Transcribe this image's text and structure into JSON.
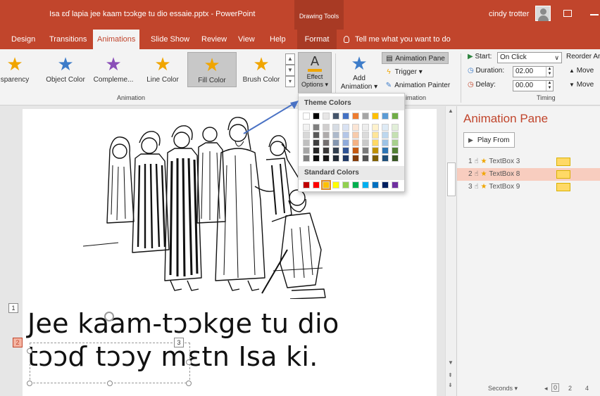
{
  "titlebar": {
    "doc_title": "Isa ɛɗ lapia jee kaam tɔɔkge tu dio essaie.pptx  -  PowerPoint",
    "context_label": "Drawing Tools",
    "user": "cindy trotter"
  },
  "tabs": {
    "items": [
      "Design",
      "Transitions",
      "Animations",
      "Slide Show",
      "Review",
      "View",
      "Help",
      "Format"
    ],
    "active": "Animations",
    "tell_me": "Tell me what you want to do"
  },
  "ribbon": {
    "gallery": [
      {
        "label": "sparency",
        "color": "#f0a500"
      },
      {
        "label": "Object Color",
        "color": "#3d7cc9"
      },
      {
        "label": "Compleme...",
        "color": "#8a4fb8"
      },
      {
        "label": "Line Color",
        "color": "#f0a500"
      },
      {
        "label": "Fill Color",
        "color": "#f0a500"
      },
      {
        "label": "Brush Color",
        "color": "#f0a500"
      }
    ],
    "selected_gallery_item": "Fill Color",
    "animation_group_label": "Animation",
    "effect_options": {
      "letter": "A",
      "line1": "Effect",
      "line2": "Options ▾"
    },
    "add_animation": {
      "line1": "Add",
      "line2": "Animation ▾"
    },
    "animation_pane_btn": "Animation Pane",
    "trigger_btn": "Trigger ▾",
    "animation_painter_btn": "Animation Painter",
    "advanced_group_label": "imation",
    "timing": {
      "start_label": "Start:",
      "start_value": "On Click",
      "duration_label": "Duration:",
      "duration_value": "02.00",
      "delay_label": "Delay:",
      "delay_value": "00.00",
      "group_label": "Timing",
      "reorder_label": "Reorder Ar",
      "move_earlier": "Move",
      "move_later": "Move"
    }
  },
  "slide": {
    "line1": "Jee kaam-tɔɔkge tu dio",
    "line2": "tɔɔɗ tɔɔy mɛtn Isa ki.",
    "tags": [
      "1",
      "2",
      "3"
    ]
  },
  "dropdown": {
    "theme_heading": "Theme Colors",
    "standard_heading": "Standard Colors",
    "theme_top": [
      "#ffffff",
      "#000000",
      "#e7e6e6",
      "#44546a",
      "#4472c4",
      "#ed7d31",
      "#a5a5a5",
      "#ffc000",
      "#5b9bd5",
      "#70ad47"
    ],
    "theme_shades": [
      [
        "#f2f2f2",
        "#7f7f7f",
        "#d0cece",
        "#d6dce4",
        "#d9e2f3",
        "#fbe5d5",
        "#ededed",
        "#fff2cc",
        "#deebf6",
        "#e2efd9"
      ],
      [
        "#d8d8d8",
        "#595959",
        "#aeabab",
        "#adb9ca",
        "#b4c6e7",
        "#f7cbac",
        "#dbdbdb",
        "#fee599",
        "#bdd7ee",
        "#c5e0b3"
      ],
      [
        "#bfbfbf",
        "#3f3f3f",
        "#757070",
        "#8496b0",
        "#8eaadb",
        "#f4b183",
        "#c9c9c9",
        "#ffd965",
        "#9dc3e6",
        "#a8d08d"
      ],
      [
        "#a5a5a5",
        "#262626",
        "#3a3838",
        "#323f4f",
        "#2f5496",
        "#c55a11",
        "#7b7b7b",
        "#bf9000",
        "#2e75b5",
        "#538135"
      ],
      [
        "#7f7f7f",
        "#0c0c0c",
        "#171616",
        "#222a35",
        "#1f3864",
        "#833c0b",
        "#525252",
        "#7f6000",
        "#1e4e79",
        "#375623"
      ]
    ],
    "standard": [
      "#c00000",
      "#ff0000",
      "#ffc000",
      "#ffff00",
      "#92d050",
      "#00b050",
      "#00b0f0",
      "#0070c0",
      "#002060",
      "#7030a0"
    ],
    "selected_standard_index": 2
  },
  "pane": {
    "title": "Animation Pane",
    "play_from": "Play From",
    "items": [
      {
        "num": "1",
        "name": "TextBox 3"
      },
      {
        "num": "2",
        "name": "TextBox 8"
      },
      {
        "num": "3",
        "name": "TextBox 9"
      }
    ],
    "selected_index": 1,
    "seconds_label": "Seconds ▾",
    "scale": [
      "0",
      "2",
      "4"
    ]
  },
  "colors": {
    "accent": "#c1452c",
    "arrow": "#4a72c4"
  }
}
